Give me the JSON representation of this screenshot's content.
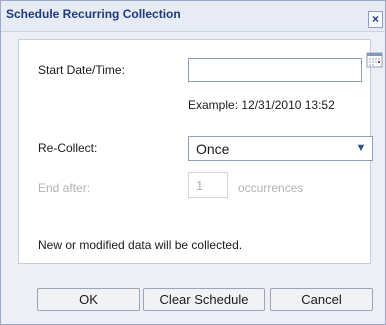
{
  "dialog": {
    "title": "Schedule Recurring Collection",
    "close_label": "×"
  },
  "form": {
    "start_label": "Start Date/Time:",
    "start_value": "",
    "example_text": "Example: 12/31/2010 13:52",
    "recollect_label": "Re-Collect:",
    "recollect_value": "Once",
    "end_after_label": "End after:",
    "end_after_value": "1",
    "occurrences_label": "occurrences",
    "note": "New or modified data will be collected."
  },
  "buttons": {
    "ok": "OK",
    "clear": "Clear Schedule",
    "cancel": "Cancel"
  },
  "icons": {
    "calendar": "calendar-icon",
    "dropdown": "chevron-down-icon",
    "close": "close-icon"
  },
  "colors": {
    "title": "#1d3b7a",
    "disabled_text": "#b3b3b3",
    "panel_bg": "#ffffff",
    "dialog_bg": "#eceff6"
  }
}
